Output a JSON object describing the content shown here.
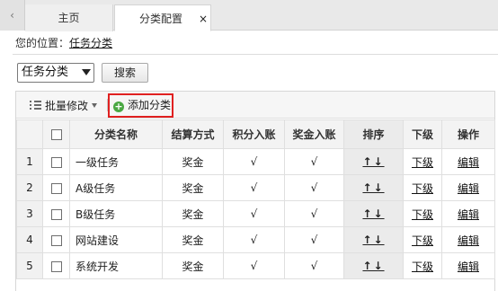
{
  "tabs": {
    "scroll_left": "‹",
    "items": [
      {
        "label": "主页"
      },
      {
        "label": "分类配置",
        "close": "×"
      }
    ]
  },
  "breadcrumb": {
    "prefix": "您的位置：",
    "link": "任务分类"
  },
  "filter": {
    "select_value": "任务分类",
    "search_label": "搜索"
  },
  "toolbar": {
    "batch_label": "批量修改",
    "add_label": "添加分类"
  },
  "table": {
    "headers": {
      "name": "分类名称",
      "settle": "结算方式",
      "points": "积分入账",
      "bonus": "奖金入账",
      "sort": "排序",
      "sub": "下级",
      "ops": "操作"
    },
    "sort_arrows": "↑↓",
    "sub_link": "下级",
    "edit_link": "编辑",
    "rows": [
      {
        "idx": "1",
        "name": "一级任务",
        "settle": "奖金",
        "points": "√",
        "bonus": "√"
      },
      {
        "idx": "2",
        "name": "A级任务",
        "settle": "奖金",
        "points": "√",
        "bonus": "√"
      },
      {
        "idx": "3",
        "name": "B级任务",
        "settle": "奖金",
        "points": "√",
        "bonus": "√"
      },
      {
        "idx": "4",
        "name": "网站建设",
        "settle": "奖金",
        "points": "√",
        "bonus": "√"
      },
      {
        "idx": "5",
        "name": "系统开发",
        "settle": "奖金",
        "points": "√",
        "bonus": "√"
      }
    ]
  },
  "colors": {
    "add_border": "#e02020",
    "plus_icon": "#4aa843"
  }
}
